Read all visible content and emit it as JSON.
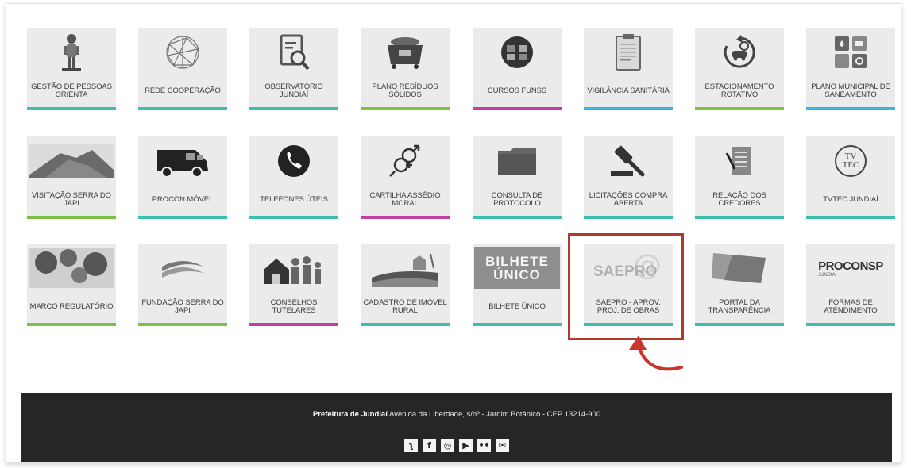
{
  "tiles": [
    {
      "label": "GESTÃO DE PESSOAS ORIENTA",
      "icon": "person-icon",
      "accent": "#3dbfb0"
    },
    {
      "label": "REDE COOPERAÇÃO",
      "icon": "network-icon",
      "accent": "#3dbfb0"
    },
    {
      "label": "OBSERVATÓRIO JUNDIAÍ",
      "icon": "document-search-icon",
      "accent": "#3dbfb0"
    },
    {
      "label": "PLANO RESÍDUOS SÓLIDOS",
      "icon": "dumpster-icon",
      "accent": "#7bc043"
    },
    {
      "label": "CURSOS FUNSS",
      "icon": "courses-icon",
      "accent": "#c53ea3"
    },
    {
      "label": "VIGILÂNCIA SANITÁRIA",
      "icon": "clipboard-icon",
      "accent": "#3bb3e0"
    },
    {
      "label": "ESTACIONAMENTO ROTATIVO",
      "icon": "parking-clock-icon",
      "accent": "#7bc043"
    },
    {
      "label": "PLANO MUNICIPAL DE SANEAMENTO",
      "icon": "sanitation-icon",
      "accent": "#3bb3e0"
    },
    {
      "label": "VISITAÇÃO SERRA DO JAPI",
      "icon": "mountain-icon",
      "accent": "#7bc043"
    },
    {
      "label": "PROCON MÓVEL",
      "icon": "van-icon",
      "accent": "#3dbfb0"
    },
    {
      "label": "TELEFONES ÚTEIS",
      "icon": "phone-icon",
      "accent": "#3dbfb0"
    },
    {
      "label": "CARTILHA ASSÉDIO MORAL",
      "icon": "gender-symbols-icon",
      "accent": "#c53ea3"
    },
    {
      "label": "CONSULTA DE PROTOCOLO",
      "icon": "folder-icon",
      "accent": "#3dbfb0"
    },
    {
      "label": "LICITAÇÕES COMPRA ABERTA",
      "icon": "gavel-icon",
      "accent": "#3dbfb0"
    },
    {
      "label": "RELAÇÃO DOS CREDORES",
      "icon": "checklist-icon",
      "accent": "#3dbfb0"
    },
    {
      "label": "TVTEC JUNDIAÍ",
      "icon": "tvtec-logo-icon",
      "accent": "#3dbfb0",
      "logo_text": "TV TEC"
    },
    {
      "label": "MARCO REGULATÓRIO",
      "icon": "tree-map-icon",
      "accent": "#7bc043"
    },
    {
      "label": "FUNDAÇÃO SERRA DO JAPI",
      "icon": "fundacao-logo-icon",
      "accent": "#7bc043"
    },
    {
      "label": "CONSELHOS TUTELARES",
      "icon": "family-house-icon",
      "accent": "#c53ea3"
    },
    {
      "label": "CADASTRO DE IMÓVEL RURAL",
      "icon": "rural-landscape-icon",
      "accent": "#3dbfb0"
    },
    {
      "label": "BILHETE ÚNICO",
      "icon": "bilhete-unico-icon",
      "accent": "#3dbfb0",
      "logo_text": "BILHETE ÚNICO"
    },
    {
      "label": "SAEPRO - APROV. PROJ. DE OBRAS",
      "icon": "saepro-logo-icon",
      "accent": "#3dbfb0",
      "logo_text": "SAEPRO"
    },
    {
      "label": "PORTAL DA TRANSPARÊNCIA",
      "icon": "transparency-card-icon",
      "accent": "#3dbfb0"
    },
    {
      "label": "FORMAS DE ATENDIMENTO",
      "icon": "procon-sp-logo-icon",
      "accent": "#3dbfb0",
      "logo_text": "PROCONSP",
      "logo_sub": "JUNDIAÍ"
    }
  ],
  "highlight": {
    "color": "#b0392b"
  },
  "footer": {
    "name": "Prefeitura de Jundiaí",
    "address": "Avenida da Liberdade, s/nº - Jardim Botânico - CEP 13214-900",
    "social": [
      {
        "icon": "rss-icon",
        "glyph": "ʅ"
      },
      {
        "icon": "facebook-icon",
        "glyph": "f"
      },
      {
        "icon": "instagram-icon",
        "glyph": "◎"
      },
      {
        "icon": "youtube-icon",
        "glyph": "▶"
      },
      {
        "icon": "flickr-icon",
        "glyph": "••"
      },
      {
        "icon": "twitter-icon",
        "glyph": "✉"
      }
    ]
  }
}
